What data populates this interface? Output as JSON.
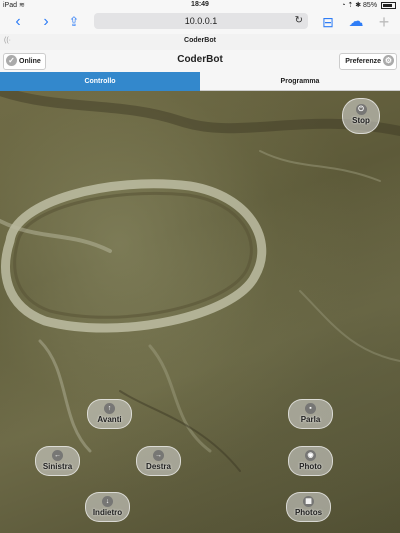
{
  "statusbar": {
    "left": "iPad ≋",
    "time": "18:49",
    "right": "◔ ⇡ ✱ 85%",
    "battery_level": 0.85
  },
  "browser": {
    "url": "10.0.0.1",
    "reload": "↻",
    "back": "‹",
    "forward": "›",
    "share": "⇪",
    "bookmarks": "⊟",
    "cloud": "☁",
    "add": "+"
  },
  "page": {
    "signal": "((·",
    "tab_title": "CoderBot"
  },
  "header": {
    "title": "CoderBot",
    "online_label": "Online",
    "online_icon": "✓",
    "pref_label": "Preferenze",
    "pref_icon": "⚙"
  },
  "tabs": [
    {
      "label": "Controllo",
      "active": true
    },
    {
      "label": "Programma",
      "active": false
    }
  ],
  "controls": {
    "stop": {
      "label": "Stop",
      "icon": "⏻"
    },
    "avanti": {
      "label": "Avanti",
      "icon": "↑"
    },
    "sinistra": {
      "label": "Sinistra",
      "icon": "←"
    },
    "destra": {
      "label": "Destra",
      "icon": "→"
    },
    "indietro": {
      "label": "Indietro",
      "icon": "↓"
    },
    "parla": {
      "label": "Parla",
      "icon": "▪"
    },
    "photo": {
      "label": "Photo",
      "icon": "◉"
    },
    "photos": {
      "label": "Photos",
      "icon": "▦"
    }
  }
}
